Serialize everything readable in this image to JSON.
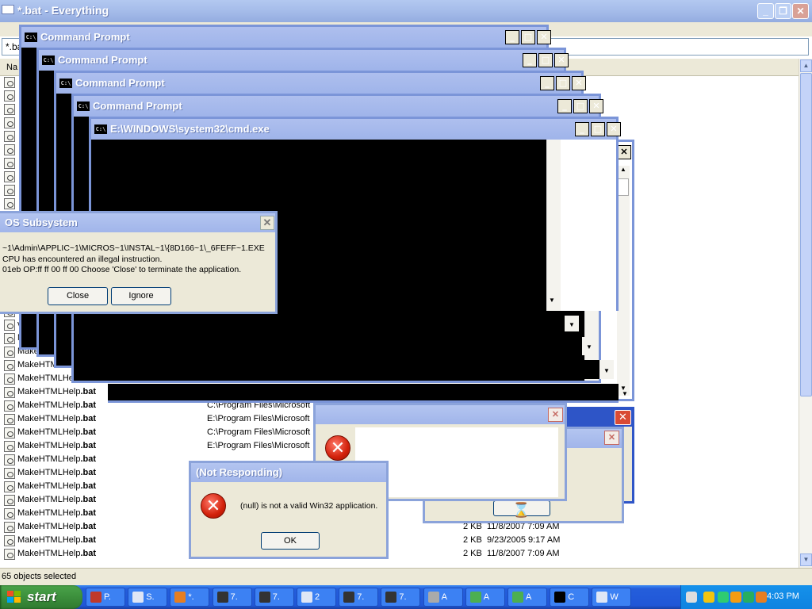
{
  "everything": {
    "title": "*.bat - Everything",
    "search_value": "*.bat",
    "header_name": "Na",
    "status": "65 objects selected",
    "rows": [
      {
        "name": "",
        "bold": "",
        "path": "",
        "size": "",
        "date": ""
      },
      {
        "name": "",
        "bold": "",
        "path": "",
        "size": "",
        "date": ""
      },
      {
        "name": "",
        "bold": "",
        "path": "",
        "size": "",
        "date": ""
      },
      {
        "name": "",
        "bold": "",
        "path": "",
        "size": "",
        "date": ""
      },
      {
        "name": "",
        "bold": "",
        "path": "",
        "size": "",
        "date": ""
      },
      {
        "name": "",
        "bold": "",
        "path": "",
        "size": "",
        "date": ""
      },
      {
        "name": "",
        "bold": "",
        "path": "",
        "size": "",
        "date": ""
      },
      {
        "name": "",
        "bold": "",
        "path": "",
        "size": "",
        "date": ""
      },
      {
        "name": "",
        "bold": "",
        "path": "",
        "size": "",
        "date": ""
      },
      {
        "name": "",
        "bold": "",
        "path": "",
        "size": "",
        "date": ""
      },
      {
        "name": "",
        "bold": "",
        "path": "",
        "size": "",
        "date": ""
      },
      {
        "name": "",
        "bold": "",
        "path": "",
        "size": "",
        "date": ""
      },
      {
        "name": "",
        "bold": "",
        "path": "",
        "size": "",
        "date": ""
      },
      {
        "name": "",
        "bold": "",
        "path": "",
        "size": "",
        "date": ""
      },
      {
        "name": "",
        "bold": "",
        "path": "",
        "size": "",
        "date": ""
      },
      {
        "name": "",
        "bold": "",
        "path": "",
        "size": "",
        "date": ""
      },
      {
        "name": "",
        "bold": "",
        "path": "",
        "size": "",
        "date": ""
      },
      {
        "name": "vcvarsia6",
        "bold": "",
        "path": "",
        "size": "",
        "date": ""
      },
      {
        "name": "vcvarsamd64.",
        "bold": "",
        "path": "",
        "size": "",
        "date": ""
      },
      {
        "name": "MakeHTMLHel",
        "bold": "",
        "path": "",
        "size": "",
        "date": ""
      },
      {
        "name": "MakeHTMLHelp",
        "bold": ".bat",
        "path": "",
        "size": "",
        "date": ""
      },
      {
        "name": "MakeHTMLHelp",
        "bold": ".bat",
        "path": "",
        "size": "",
        "date": ""
      },
      {
        "name": "MakeHTMLHelp",
        "bold": ".bat",
        "path": "",
        "size": "",
        "date": ""
      },
      {
        "name": "MakeHTMLHelp",
        "bold": ".bat",
        "path": "",
        "size": "",
        "date": ""
      },
      {
        "name": "MakeHTMLHelp",
        "bold": ".bat",
        "path": "C:\\Program Files\\Microsoft",
        "size": "",
        "date": ""
      },
      {
        "name": "MakeHTMLHelp",
        "bold": ".bat",
        "path": "E:\\Program Files\\Microsoft",
        "size": "",
        "date": ""
      },
      {
        "name": "MakeHTMLHelp",
        "bold": ".bat",
        "path": "C:\\Program Files\\Microsoft",
        "size": "",
        "date": ""
      },
      {
        "name": "MakeHTMLHelp",
        "bold": ".bat",
        "path": "E:\\Program Files\\Microsoft",
        "size": "",
        "date": ""
      },
      {
        "name": "MakeHTMLHelp",
        "bold": ".bat",
        "path": "",
        "size": "",
        "date": ""
      },
      {
        "name": "MakeHTMLHelp",
        "bold": ".bat",
        "path": "",
        "size": "",
        "date": ""
      },
      {
        "name": "MakeHTMLHelp",
        "bold": ".bat",
        "path": "",
        "size": "",
        "date": ""
      },
      {
        "name": "MakeHTMLHelp",
        "bold": ".bat",
        "path": "",
        "size": "",
        "date": ""
      },
      {
        "name": "MakeHTMLHelp",
        "bold": ".bat",
        "path": "",
        "size": "",
        "date": ""
      },
      {
        "name": "MakeHTMLHelp",
        "bold": ".bat",
        "path": "",
        "size": "2 KB",
        "date": "11/8/2007 7:09 AM"
      },
      {
        "name": "MakeHTMLHelp",
        "bold": ".bat",
        "path": "",
        "size": "2 KB",
        "date": "9/23/2005 9:17 AM"
      },
      {
        "name": "MakeHTMLHelp",
        "bold": ".bat",
        "path": "",
        "size": "2 KB",
        "date": "11/8/2007 7:09 AM"
      }
    ]
  },
  "cmd_windows": [
    {
      "title": "Command Prompt"
    },
    {
      "title": "Command Prompt"
    },
    {
      "title": "Command Prompt"
    },
    {
      "title": "Command Prompt"
    },
    {
      "title": "E:\\WINDOWS\\system32\\cmd.exe"
    }
  ],
  "os_dialog": {
    "title": "OS Subsystem",
    "line1": "~1\\Admin\\APPLIC~1\\MICROS~1\\INSTAL~1\\{8D166~1\\_6FEFF~1.EXE",
    "line2": "CPU has encountered an illegal instruction.",
    "line3": "01eb OP:ff ff 00 ff 00 Choose 'Close' to terminate the application.",
    "close_label": "Close",
    "ignore_label": "Ignore"
  },
  "notresp_dialog": {
    "title": "(Not Responding)",
    "message": "(null) is not a valid Win32 application.",
    "ok_label": "OK"
  },
  "taskbar": {
    "start_label": "start",
    "items": [
      {
        "label": "P.",
        "color": "#c0392b"
      },
      {
        "label": "S.",
        "color": "#dfe6f5"
      },
      {
        "label": "*.",
        "color": "#e67e22"
      },
      {
        "label": "7.",
        "color": "#333333"
      },
      {
        "label": "7.",
        "color": "#333333"
      },
      {
        "label": "2",
        "color": "#dfe6f5"
      },
      {
        "label": "7.",
        "color": "#333333"
      },
      {
        "label": "7.",
        "color": "#333333"
      },
      {
        "label": "A",
        "color": "#aaaaaa"
      },
      {
        "label": "A",
        "color": "#4caf50"
      },
      {
        "label": "A",
        "color": "#4caf50"
      },
      {
        "label": "C",
        "color": "#000000"
      },
      {
        "label": "W",
        "color": "#dfe6f5"
      }
    ],
    "clock": "4:03 PM"
  }
}
